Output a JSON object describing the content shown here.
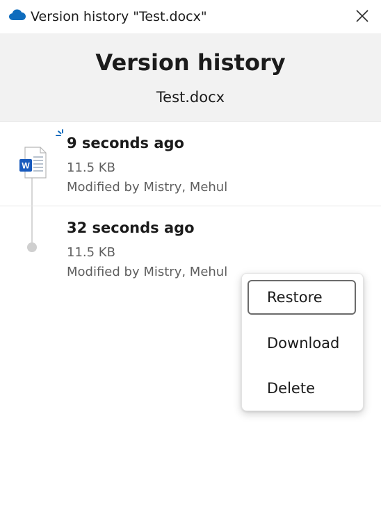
{
  "window": {
    "title": "Version history \"Test.docx\"",
    "app_icon": "onedrive-cloud-icon",
    "close_icon": "close-icon",
    "accent_color": "#0f6cbd"
  },
  "header": {
    "title": "Version history",
    "file_name": "Test.docx"
  },
  "versions": [
    {
      "time": "9 seconds ago",
      "size": "11.5 KB",
      "modified_by": "Modified by Mistry, Mehul",
      "icon": "word-document-icon",
      "current": true
    },
    {
      "time": "32 seconds ago",
      "size": "11.5 KB",
      "modified_by": "Modified by Mistry, Mehul",
      "current": false
    }
  ],
  "context_menu": {
    "items": [
      {
        "label": "Restore",
        "focused": true
      },
      {
        "label": "Download",
        "focused": false
      },
      {
        "label": "Delete",
        "focused": false
      }
    ]
  }
}
